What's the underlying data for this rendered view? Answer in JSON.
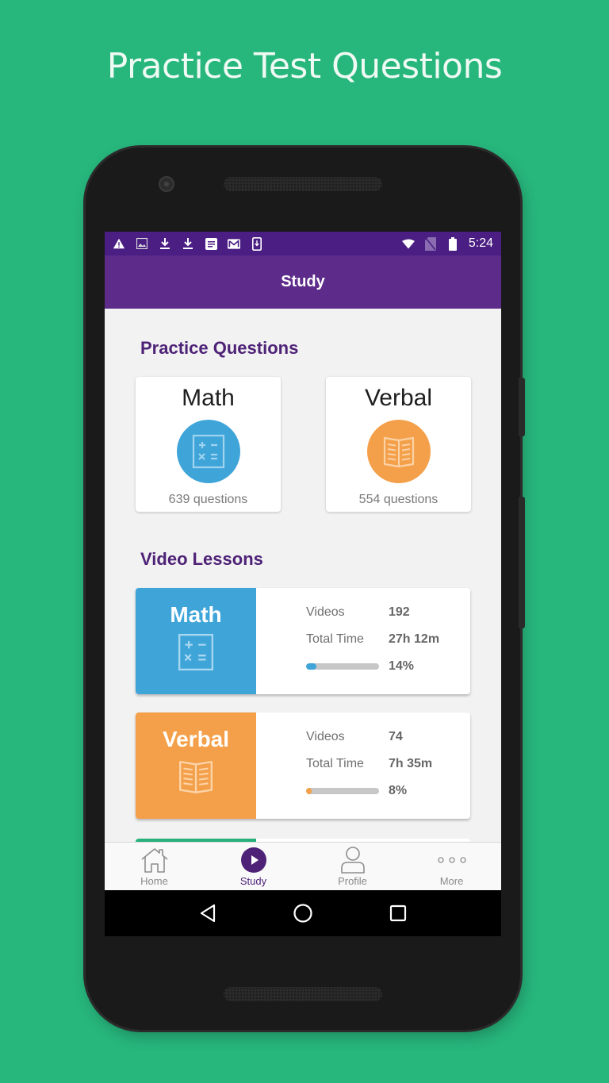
{
  "promo": {
    "title": "Practice Test Questions"
  },
  "status_bar": {
    "left_icons": [
      "warning-icon",
      "image-icon",
      "download-icon",
      "download-icon",
      "document-icon",
      "mail-icon",
      "device-download-icon"
    ],
    "right_icons": [
      "wifi-icon",
      "no-sim-icon",
      "battery-icon"
    ],
    "time": "5:24"
  },
  "app_bar": {
    "title": "Study"
  },
  "practice_questions": {
    "heading": "Practice Questions",
    "cards": [
      {
        "title": "Math",
        "count_label": "639 questions",
        "icon": "calculator-icon",
        "color": "#3fa5d9"
      },
      {
        "title": "Verbal",
        "count_label": "554 questions",
        "icon": "book-icon",
        "color": "#f4a04a"
      }
    ]
  },
  "video_lessons": {
    "heading": "Video Lessons",
    "videos_label": "Videos",
    "total_time_label": "Total Time",
    "cards": [
      {
        "title": "Math",
        "icon": "calculator-icon",
        "color": "#3fa5d9",
        "videos": "192",
        "total_time": "27h 12m",
        "progress_label": "14%",
        "progress": 0.14
      },
      {
        "title": "Verbal",
        "icon": "book-icon",
        "color": "#f4a04a",
        "videos": "74",
        "total_time": "7h 35m",
        "progress_label": "8%",
        "progress": 0.08
      }
    ],
    "peek_color": "#27b07a"
  },
  "bottom_nav": {
    "items": [
      {
        "label": "Home",
        "icon": "home-icon",
        "active": false
      },
      {
        "label": "Study",
        "icon": "play-circle-icon",
        "active": true
      },
      {
        "label": "Profile",
        "icon": "person-icon",
        "active": false
      },
      {
        "label": "More",
        "icon": "more-dots-icon",
        "active": false
      }
    ]
  },
  "system_nav": {
    "buttons": [
      "back-icon",
      "home-circle-icon",
      "recents-icon"
    ]
  },
  "colors": {
    "background": "#27b67c",
    "status_bar": "#4a1e82",
    "app_bar": "#5d2c8a",
    "heading": "#4e2277",
    "math": "#3fa5d9",
    "verbal": "#f4a04a"
  }
}
